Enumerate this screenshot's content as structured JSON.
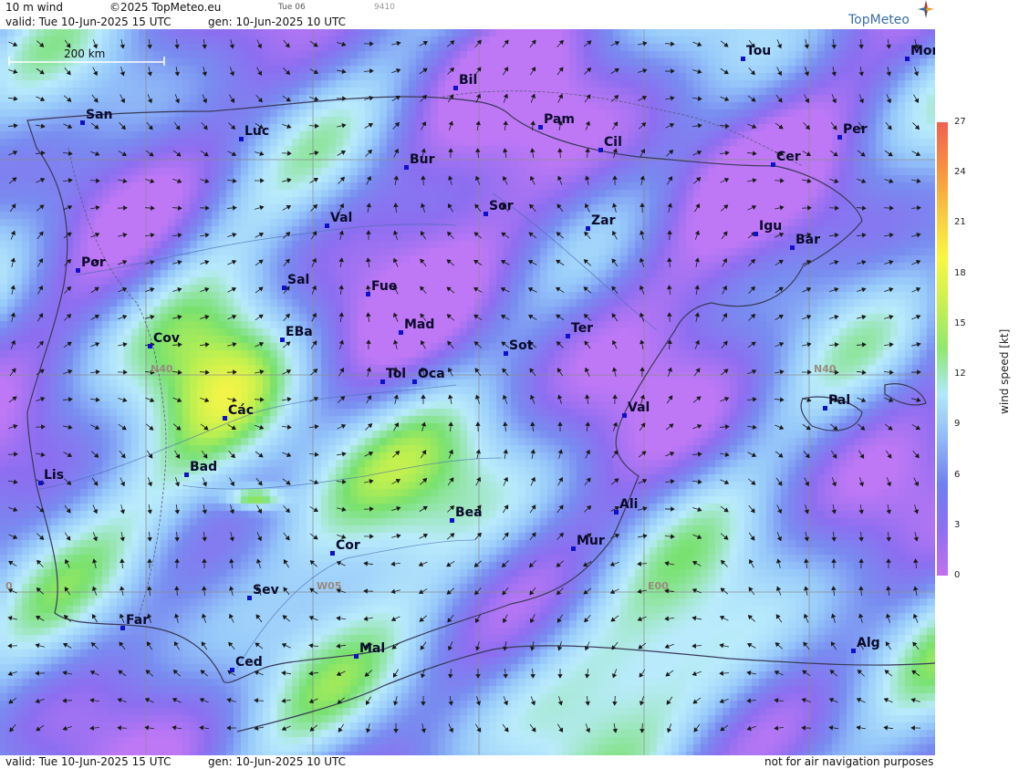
{
  "header": {
    "product": "10 m wind",
    "copyright": "©2025 TopMeteo.eu",
    "day": "Tue 06",
    "code": "9410",
    "valid": "valid:  Tue  10-Jun-2025  15 UTC",
    "gen": "gen: 10-Jun-2025 10 UTC",
    "brand": "TopMeteo"
  },
  "footer": {
    "valid": "valid:  Tue  10-Jun-2025  15 UTC",
    "gen": "gen: 10-Jun-2025 10 UTC",
    "disclaimer": "not for air navigation purposes"
  },
  "scale_bar": {
    "label": "200 km"
  },
  "grid_labels": {
    "lat": "N40",
    "lat_east": "N40",
    "lon_w5": "W05",
    "lon_e0": "E00",
    "lon_w10": "0"
  },
  "cities": [
    {
      "name": "San"
    },
    {
      "name": "Luc"
    },
    {
      "name": "Bil"
    },
    {
      "name": "Tou"
    },
    {
      "name": "Mon"
    },
    {
      "name": "Pam"
    },
    {
      "name": "Cil"
    },
    {
      "name": "Per"
    },
    {
      "name": "Bur"
    },
    {
      "name": "Cer"
    },
    {
      "name": "Sor"
    },
    {
      "name": "Val"
    },
    {
      "name": "Zar"
    },
    {
      "name": "Igu"
    },
    {
      "name": "Bar"
    },
    {
      "name": "Por"
    },
    {
      "name": "Sal"
    },
    {
      "name": "Fue"
    },
    {
      "name": "Mad"
    },
    {
      "name": "Ter"
    },
    {
      "name": "Cov"
    },
    {
      "name": "EBa"
    },
    {
      "name": "Sot"
    },
    {
      "name": "Tol"
    },
    {
      "name": "Oca"
    },
    {
      "name": "Pal"
    },
    {
      "name": "Các"
    },
    {
      "name": "Val"
    },
    {
      "name": "Bad"
    },
    {
      "name": "Lis"
    },
    {
      "name": "Bea"
    },
    {
      "name": "Ali"
    },
    {
      "name": "Mur"
    },
    {
      "name": "Cor"
    },
    {
      "name": "Sev"
    },
    {
      "name": "Far"
    },
    {
      "name": "Alg"
    },
    {
      "name": "Mal"
    },
    {
      "name": "Ced"
    }
  ],
  "legend": {
    "title": "wind speed [kt]",
    "ticks": [
      "27",
      "24",
      "21",
      "18",
      "15",
      "12",
      "9",
      "6",
      "3",
      "0"
    ],
    "colors": [
      "#c070f0",
      "#9070f0",
      "#7080f0",
      "#90b8f8",
      "#b0e8fc",
      "#90e870",
      "#c8f050",
      "#f8f840",
      "#f8c840",
      "#f89040",
      "#f06050"
    ]
  }
}
